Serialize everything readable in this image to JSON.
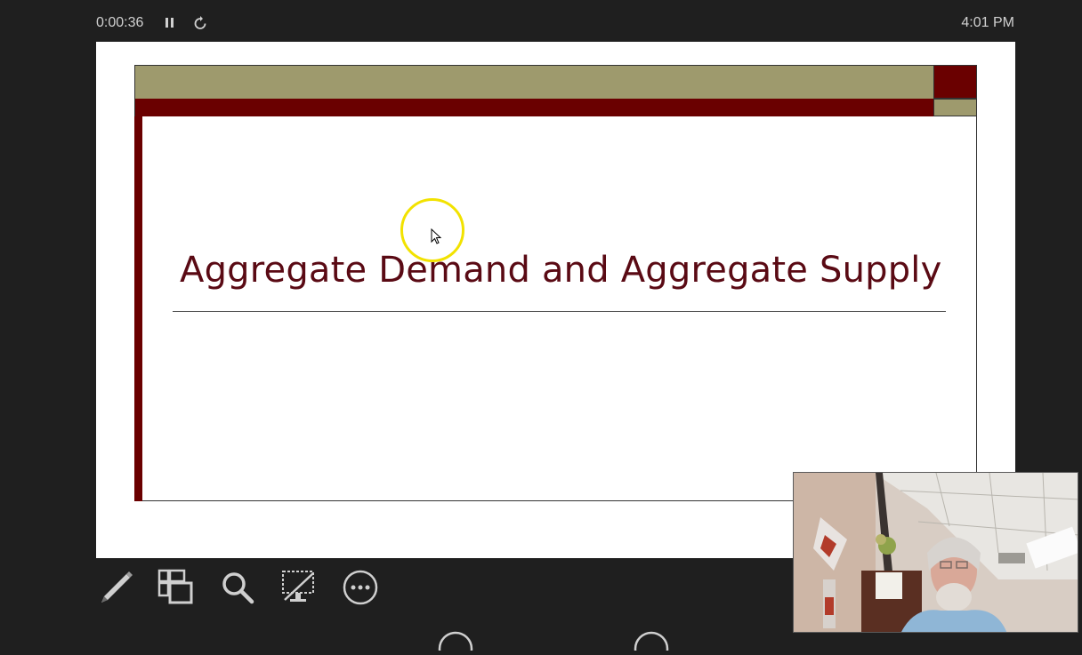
{
  "presenter": {
    "elapsed_time": "0:00:36",
    "clock": "4:01 PM",
    "pause_icon": "pause-icon",
    "restart_icon": "restart-icon"
  },
  "slide": {
    "title": "Aggregate Demand and Aggregate Supply",
    "colors": {
      "olive": "#9e9a6d",
      "maroon": "#6a0000",
      "title_text": "#5a0a14",
      "laser_pointer": "#f2e200"
    }
  },
  "toolbar": {
    "tools": [
      {
        "name": "pen-icon"
      },
      {
        "name": "see-all-slides-icon"
      },
      {
        "name": "zoom-icon"
      },
      {
        "name": "black-screen-icon"
      },
      {
        "name": "more-options-icon"
      }
    ]
  },
  "webcam": {
    "description_icon": "presenter-webcam-video"
  }
}
